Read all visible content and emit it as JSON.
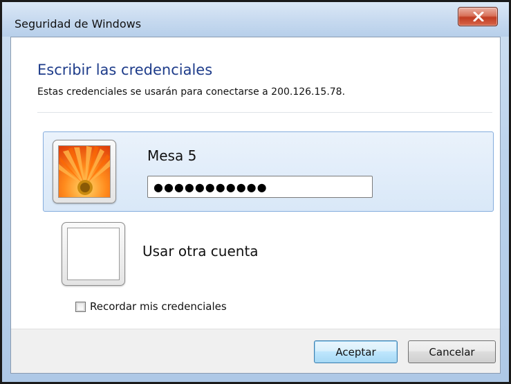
{
  "window": {
    "title": "Seguridad de Windows",
    "close_icon": "close-x-icon",
    "accent_color": "#1e3c8a"
  },
  "dialog": {
    "heading": "Escribir las credenciales",
    "subtitle": "Estas credenciales se usarán para conectarse a 200.126.15.78."
  },
  "credentials": {
    "selected": {
      "user_name": "Mesa 5",
      "avatar_icon": "orange-flower-avatar-icon",
      "password_masked": "●●●●●●●●●●●"
    },
    "other": {
      "label": "Usar otra cuenta",
      "avatar_icon": "blank-avatar-icon"
    }
  },
  "remember": {
    "label": "Recordar mis credenciales",
    "checked": false
  },
  "buttons": {
    "ok_label": "Aceptar",
    "cancel_label": "Cancelar"
  }
}
